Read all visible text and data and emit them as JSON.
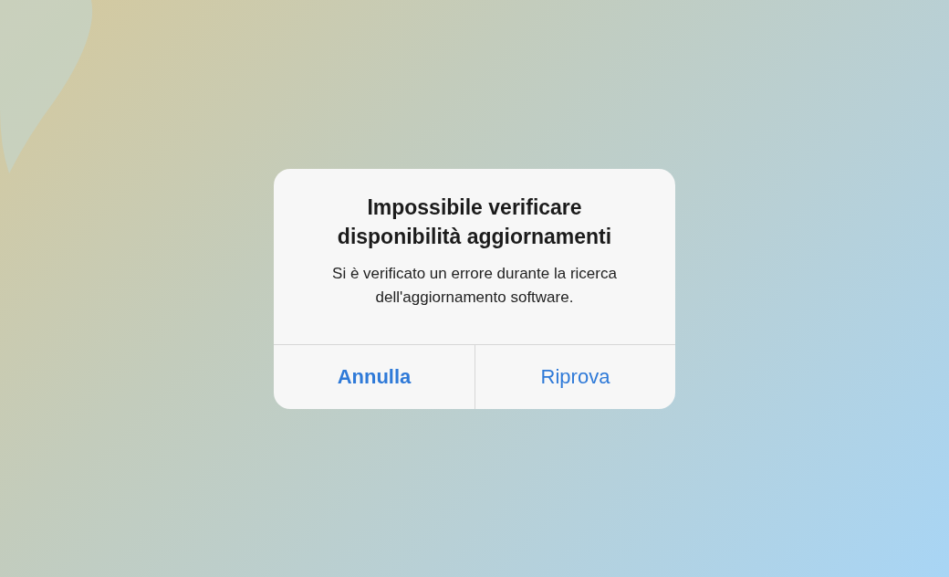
{
  "dialog": {
    "title": "Impossibile verificare disponibilità aggiornamenti",
    "message": "Si è verificato un errore durante la ricerca dell'aggiornamento software.",
    "buttons": [
      {
        "label": "Annulla",
        "emphasized": true
      },
      {
        "label": "Riprova",
        "emphasized": false
      }
    ]
  }
}
